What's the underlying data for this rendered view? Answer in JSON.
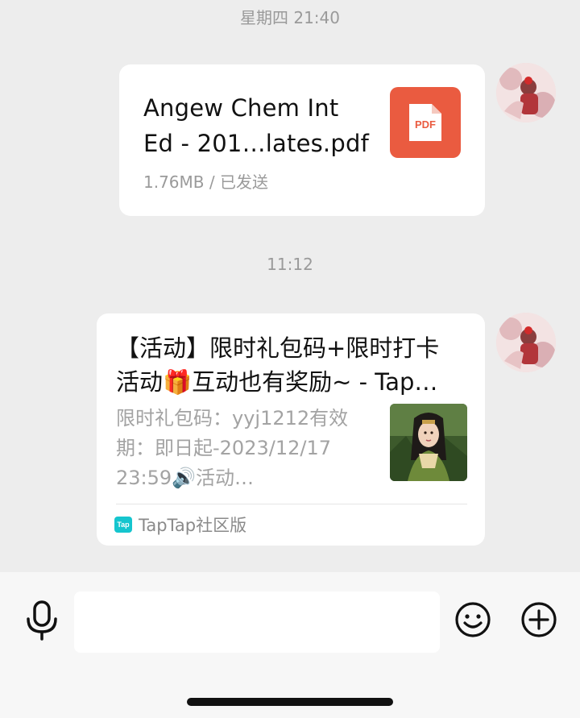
{
  "chat": {
    "timestamp_1": "星期四 21:40",
    "timestamp_2": "11:12"
  },
  "file_message": {
    "name_line1": "Angew Chem Int",
    "name_line2": "Ed - 201…lates.pdf",
    "meta": "1.76MB / 已发送",
    "icon_label": "PDF",
    "icon_color": "#ea5b40"
  },
  "link_message": {
    "title_line1": "【活动】限时礼包码+限时打卡",
    "title_line2": "活动🎁互动也有奖励~ - Tap…",
    "desc_line1": "限时礼包码：yyj1212有效",
    "desc_line2": "期：即日起-2023/12/17",
    "desc_line3": "23:59🔊活动…",
    "source_icon_label": "Tap",
    "source": "TapTap社区版"
  },
  "input_bar": {
    "placeholder": "",
    "voice_icon": "microphone-icon",
    "emoji_icon": "smiley-icon",
    "plus_icon": "plus-circle-icon"
  },
  "colors": {
    "background": "#ededed",
    "bubble": "#ffffff",
    "pdf_red": "#ea5b40",
    "taptap_teal": "#15c5ce"
  }
}
